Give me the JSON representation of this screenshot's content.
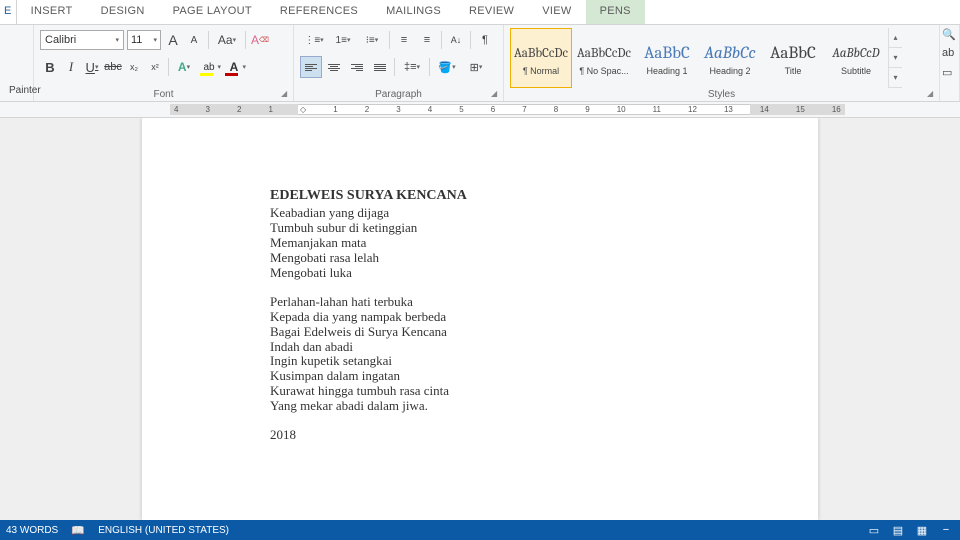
{
  "tabs": {
    "partial": "E",
    "items": [
      "INSERT",
      "DESIGN",
      "PAGE LAYOUT",
      "REFERENCES",
      "MAILINGS",
      "REVIEW",
      "VIEW",
      "PENS"
    ],
    "active": "PENS"
  },
  "clipboard": {
    "painter": "Painter"
  },
  "font": {
    "family": "Calibri",
    "size": "11",
    "grow": "A",
    "shrink": "A",
    "case": "Aa",
    "clear": "⌫",
    "bold": "B",
    "italic": "I",
    "underline": "U",
    "strike": "abc",
    "sub": "x",
    "sup": "x",
    "effects": "A",
    "highlight": "ab",
    "color": "A",
    "group_label": "Font"
  },
  "paragraph": {
    "group_label": "Paragraph",
    "pilcrow": "¶",
    "sort": "A↓",
    "indent_dec": "≡←",
    "indent_inc": "≡→"
  },
  "styles": {
    "group_label": "Styles",
    "items": [
      {
        "preview": "AaBbCcDc",
        "name": "¶ Normal",
        "cls": ""
      },
      {
        "preview": "AaBbCcDc",
        "name": "¶ No Spac...",
        "cls": ""
      },
      {
        "preview": "AaBbC",
        "name": "Heading 1",
        "cls": "big blue"
      },
      {
        "preview": "AaBbCc",
        "name": "Heading 2",
        "cls": "big blue italic"
      },
      {
        "preview": "AaBbC",
        "name": "Title",
        "cls": "big"
      },
      {
        "preview": "AaBbCcD",
        "name": "Subtitle",
        "cls": "italic"
      }
    ]
  },
  "ruler": {
    "left": [
      "4",
      "3",
      "2",
      "1"
    ],
    "right": [
      "1",
      "2",
      "3",
      "4",
      "5",
      "6",
      "7",
      "8",
      "9",
      "10",
      "11",
      "12",
      "13",
      "14",
      "15",
      "16"
    ]
  },
  "document": {
    "title": "EDELWEIS SURYA KENCANA",
    "stanza1": [
      "Keabadian yang dijaga",
      "Tumbuh subur di ketinggian",
      "Memanjakan mata",
      "Mengobati rasa lelah",
      "Mengobati luka"
    ],
    "stanza2": [
      "Perlahan-lahan hati terbuka",
      "Kepada dia yang nampak berbeda",
      "Bagai Edelweis di Surya Kencana",
      "Indah dan abadi",
      "Ingin kupetik setangkai",
      "Kusimpan dalam ingatan",
      "Kurawat hingga tumbuh rasa cinta",
      "Yang mekar abadi dalam jiwa."
    ],
    "year": "2018"
  },
  "statusbar": {
    "words": "43 WORDS",
    "lang": "ENGLISH (UNITED STATES)"
  }
}
